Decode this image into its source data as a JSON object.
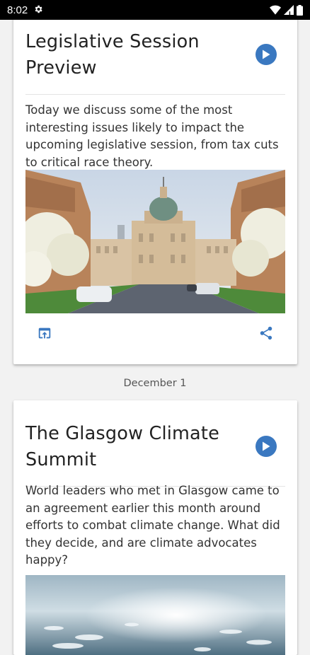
{
  "status_bar": {
    "time": "8:02",
    "icons": [
      "settings-icon",
      "wifi-icon",
      "signal-icon",
      "battery-icon"
    ]
  },
  "feed": {
    "date_separator": "December 1",
    "episodes": [
      {
        "title": "Legislative Session Preview",
        "description": "Today we discuss some of the most interesting issues likely to impact the upcoming legislative session, from tax cuts to critical race theory.",
        "image": "statehouse-photo",
        "actions": [
          "open-in-browser-icon",
          "share-icon"
        ]
      },
      {
        "title": "The Glasgow Climate Summit",
        "description": "World leaders who met in Glasgow came to an agreement earlier this month around efforts to combat climate change. What did they decide, and are climate advocates happy?",
        "image": "ocean-ice-photo"
      }
    ]
  },
  "colors": {
    "accent": "#3a78c0",
    "status_bar": "#000000",
    "background": "#f2f2f2"
  }
}
